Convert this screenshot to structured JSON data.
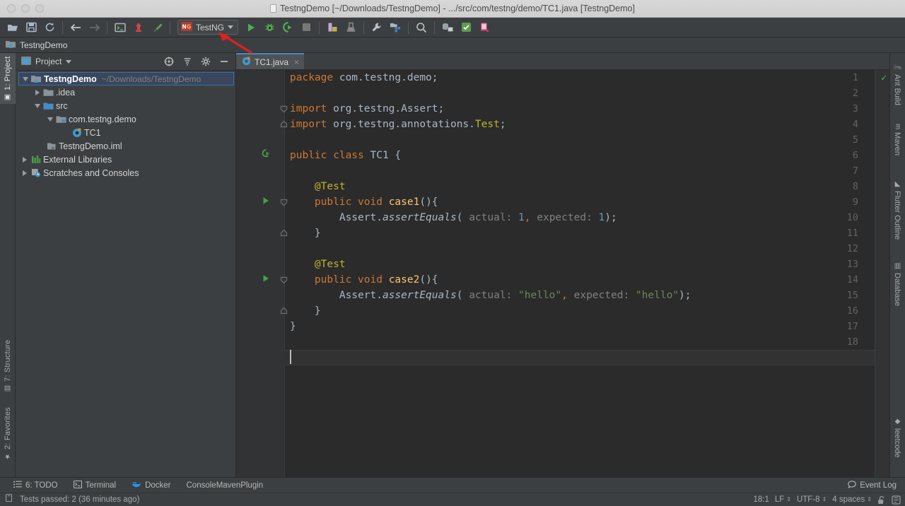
{
  "window": {
    "title": "TestngDemo [~/Downloads/TestngDemo] - .../src/com/testng/demo/TC1.java [TestngDemo]"
  },
  "toolbar": {
    "buttons": [
      {
        "name": "open-project-icon",
        "glyph": "open-folder"
      },
      {
        "name": "save-all-icon",
        "glyph": "floppy"
      },
      {
        "name": "sync-icon",
        "glyph": "refresh"
      },
      {
        "name": "back-icon",
        "glyph": "arrow-left"
      },
      {
        "name": "forward-icon",
        "glyph": "arrow-right"
      },
      {
        "name": "toggle-terminal-icon",
        "glyph": "console"
      },
      {
        "name": "update-project-icon",
        "glyph": "vcs-update"
      },
      {
        "name": "commit-icon",
        "glyph": "hammer"
      }
    ],
    "run_config": {
      "label": "TestNG",
      "icon": "testng-icon"
    },
    "right_buttons": [
      {
        "name": "run-button",
        "glyph": "play"
      },
      {
        "name": "debug-button",
        "glyph": "bug"
      },
      {
        "name": "run-with-coverage-button",
        "glyph": "coverage"
      },
      {
        "name": "stop-button",
        "glyph": "stop"
      },
      {
        "name": "build-project-button",
        "glyph": "build"
      },
      {
        "name": "attach-profiler-button",
        "glyph": "profiler"
      },
      {
        "name": "settings-button",
        "glyph": "wrench"
      },
      {
        "name": "project-structure-button",
        "glyph": "structure"
      },
      {
        "name": "search-everywhere-button",
        "glyph": "magnifier"
      },
      {
        "name": "database-button",
        "glyph": "db"
      },
      {
        "name": "android-sdk-button",
        "glyph": "sdk"
      },
      {
        "name": "android-device-button",
        "glyph": "device"
      }
    ]
  },
  "navbar": {
    "crumb": "TestngDemo"
  },
  "left_strip": {
    "tabs": [
      {
        "label": "1: Project",
        "icon": "project-icon",
        "active": true
      },
      {
        "label": "7: Structure",
        "icon": "structure-icon",
        "active": false
      },
      {
        "label": "2: Favorites",
        "icon": "star-icon",
        "active": false
      }
    ]
  },
  "right_strip": {
    "tabs": [
      {
        "label": "Ant Build",
        "icon": "ant-icon"
      },
      {
        "label": "Maven",
        "icon": "maven-icon"
      },
      {
        "label": "Flutter Outline",
        "icon": "flutter-icon"
      },
      {
        "label": "Database",
        "icon": "database-icon"
      },
      {
        "label": "leetcode",
        "icon": "leetcode-icon"
      }
    ]
  },
  "project_panel": {
    "title": "Project",
    "header_buttons": [
      {
        "name": "select-opened-file-button",
        "glyph": "target"
      },
      {
        "name": "collapse-all-button",
        "glyph": "collapse"
      },
      {
        "name": "settings-gear-button",
        "glyph": "gear"
      },
      {
        "name": "hide-panel-button",
        "glyph": "minus"
      }
    ],
    "tree": [
      {
        "label": "TestngDemo",
        "sub": "~/Downloads/TestngDemo",
        "indent": 0,
        "twisty": "down",
        "icon": "module-icon",
        "selected": true
      },
      {
        "label": ".idea",
        "sub": "",
        "indent": 1,
        "twisty": "right",
        "icon": "folder-icon",
        "selected": false
      },
      {
        "label": "src",
        "sub": "",
        "indent": 1,
        "twisty": "down",
        "icon": "source-folder-icon",
        "selected": false
      },
      {
        "label": "com.testng.demo",
        "sub": "",
        "indent": 2,
        "twisty": "down",
        "icon": "package-icon",
        "selected": false
      },
      {
        "label": "TC1",
        "sub": "",
        "indent": 3,
        "twisty": "none",
        "icon": "java-class-icon",
        "selected": false
      },
      {
        "label": "TestngDemo.iml",
        "sub": "",
        "indent": 1,
        "twisty": "none",
        "icon": "iml-icon",
        "selected": false
      },
      {
        "label": "External Libraries",
        "sub": "",
        "indent": 0,
        "twisty": "right",
        "icon": "libraries-icon",
        "selected": false
      },
      {
        "label": "Scratches and Consoles",
        "sub": "",
        "indent": 0,
        "twisty": "right",
        "icon": "scratches-icon",
        "selected": false
      }
    ]
  },
  "editor": {
    "tab": {
      "label": "TC1.java",
      "icon": "java-class-icon",
      "close": "×"
    },
    "inspection_status": "✓",
    "line_numbers": [
      "1",
      "2",
      "3",
      "4",
      "5",
      "6",
      "7",
      "8",
      "9",
      "10",
      "11",
      "12",
      "13",
      "14",
      "15",
      "16",
      "17",
      "18"
    ],
    "code": [
      {
        "n": 1,
        "segments": [
          {
            "t": "package ",
            "c": "kw"
          },
          {
            "t": "com.testng.demo;",
            "c": "txt"
          }
        ]
      },
      {
        "n": 2,
        "segments": []
      },
      {
        "n": 3,
        "segments": [
          {
            "t": "import ",
            "c": "kw"
          },
          {
            "t": "org.testng.Assert;",
            "c": "txt"
          }
        ]
      },
      {
        "n": 4,
        "segments": [
          {
            "t": "import ",
            "c": "kw"
          },
          {
            "t": "org.testng.annotations.",
            "c": "txt"
          },
          {
            "t": "Test",
            "c": "ann"
          },
          {
            "t": ";",
            "c": "txt"
          }
        ]
      },
      {
        "n": 5,
        "segments": []
      },
      {
        "n": 6,
        "segments": [
          {
            "t": "public class ",
            "c": "kw"
          },
          {
            "t": "TC1 ",
            "c": "txt"
          },
          {
            "t": "{",
            "c": "txt"
          }
        ]
      },
      {
        "n": 7,
        "segments": []
      },
      {
        "n": 8,
        "segments": [
          {
            "t": "    @Test",
            "c": "ann"
          }
        ]
      },
      {
        "n": 9,
        "segments": [
          {
            "t": "    ",
            "c": "txt"
          },
          {
            "t": "public void ",
            "c": "kw"
          },
          {
            "t": "case1",
            "c": "mth"
          },
          {
            "t": "(){",
            "c": "txt"
          }
        ]
      },
      {
        "n": 10,
        "segments": [
          {
            "t": "        Assert.",
            "c": "txt"
          },
          {
            "t": "assertEquals",
            "c": "stat"
          },
          {
            "t": "( ",
            "c": "txt"
          },
          {
            "t": "actual:",
            "c": "hint"
          },
          {
            "t": " ",
            "c": "txt"
          },
          {
            "t": "1",
            "c": "num"
          },
          {
            "t": ",",
            "c": "kw"
          },
          {
            "t": " ",
            "c": "txt"
          },
          {
            "t": "expected:",
            "c": "hint"
          },
          {
            "t": " ",
            "c": "txt"
          },
          {
            "t": "1",
            "c": "num"
          },
          {
            "t": ");",
            "c": "txt"
          }
        ]
      },
      {
        "n": 11,
        "segments": [
          {
            "t": "    }",
            "c": "txt"
          }
        ]
      },
      {
        "n": 12,
        "segments": []
      },
      {
        "n": 13,
        "segments": [
          {
            "t": "    @Test",
            "c": "ann"
          }
        ]
      },
      {
        "n": 14,
        "segments": [
          {
            "t": "    ",
            "c": "txt"
          },
          {
            "t": "public void ",
            "c": "kw"
          },
          {
            "t": "case2",
            "c": "mth"
          },
          {
            "t": "(){",
            "c": "txt"
          }
        ]
      },
      {
        "n": 15,
        "segments": [
          {
            "t": "        Assert.",
            "c": "txt"
          },
          {
            "t": "assertEquals",
            "c": "stat"
          },
          {
            "t": "( ",
            "c": "txt"
          },
          {
            "t": "actual:",
            "c": "hint"
          },
          {
            "t": " ",
            "c": "txt"
          },
          {
            "t": "\"hello\"",
            "c": "str"
          },
          {
            "t": ",",
            "c": "kw"
          },
          {
            "t": " ",
            "c": "txt"
          },
          {
            "t": "expected:",
            "c": "hint"
          },
          {
            "t": " ",
            "c": "txt"
          },
          {
            "t": "\"hello\"",
            "c": "str"
          },
          {
            "t": ");",
            "c": "txt"
          }
        ]
      },
      {
        "n": 16,
        "segments": [
          {
            "t": "    }",
            "c": "txt"
          }
        ]
      },
      {
        "n": 17,
        "segments": [
          {
            "t": "}",
            "c": "txt"
          }
        ]
      },
      {
        "n": 18,
        "segments": []
      }
    ],
    "gutter_icons": [
      {
        "line": 6,
        "type": "run-class-icon"
      },
      {
        "line": 9,
        "type": "run-test-icon"
      },
      {
        "line": 14,
        "type": "run-test-icon"
      }
    ],
    "fold_markers": [
      {
        "line": 3,
        "type": "fold-collapse-start"
      },
      {
        "line": 4,
        "type": "fold-collapse-end"
      },
      {
        "line": 9,
        "type": "fold-collapse-start"
      },
      {
        "line": 11,
        "type": "fold-collapse-end"
      },
      {
        "line": 14,
        "type": "fold-collapse-start"
      },
      {
        "line": 16,
        "type": "fold-collapse-end"
      }
    ]
  },
  "bottom_bar": {
    "tabs": [
      {
        "label": "6: TODO",
        "icon": "todo-icon"
      },
      {
        "label": "Terminal",
        "icon": "terminal-icon"
      },
      {
        "label": "Docker",
        "icon": "docker-icon"
      },
      {
        "label": "ConsoleMavenPlugin",
        "icon": ""
      }
    ],
    "event_log": {
      "label": "Event Log",
      "icon": "balloon-icon"
    }
  },
  "status_bar": {
    "message": "Tests passed: 2 (36 minutes ago)",
    "message_icon": "copy-icon",
    "caret": "18:1",
    "line_separator": "LF",
    "encoding": "UTF-8",
    "indent": "4 spaces",
    "lock_icon": "unlocked-icon",
    "inspector_icon": "inspector-icon"
  },
  "annotation": {
    "arrow_color": "#e02020",
    "points_to": "run-button"
  },
  "colors": {
    "accent": "#4a88c7",
    "ide_bg": "#3c3f41",
    "editor_bg": "#2b2b2b",
    "gutter_bg": "#313335",
    "keyword": "#cc7832",
    "string": "#6a8759",
    "number": "#6897bb",
    "annotation": "#bbb529",
    "method": "#ffc66d",
    "text": "#a9b7c6",
    "hint": "#808080",
    "run_green": "#62b543"
  }
}
